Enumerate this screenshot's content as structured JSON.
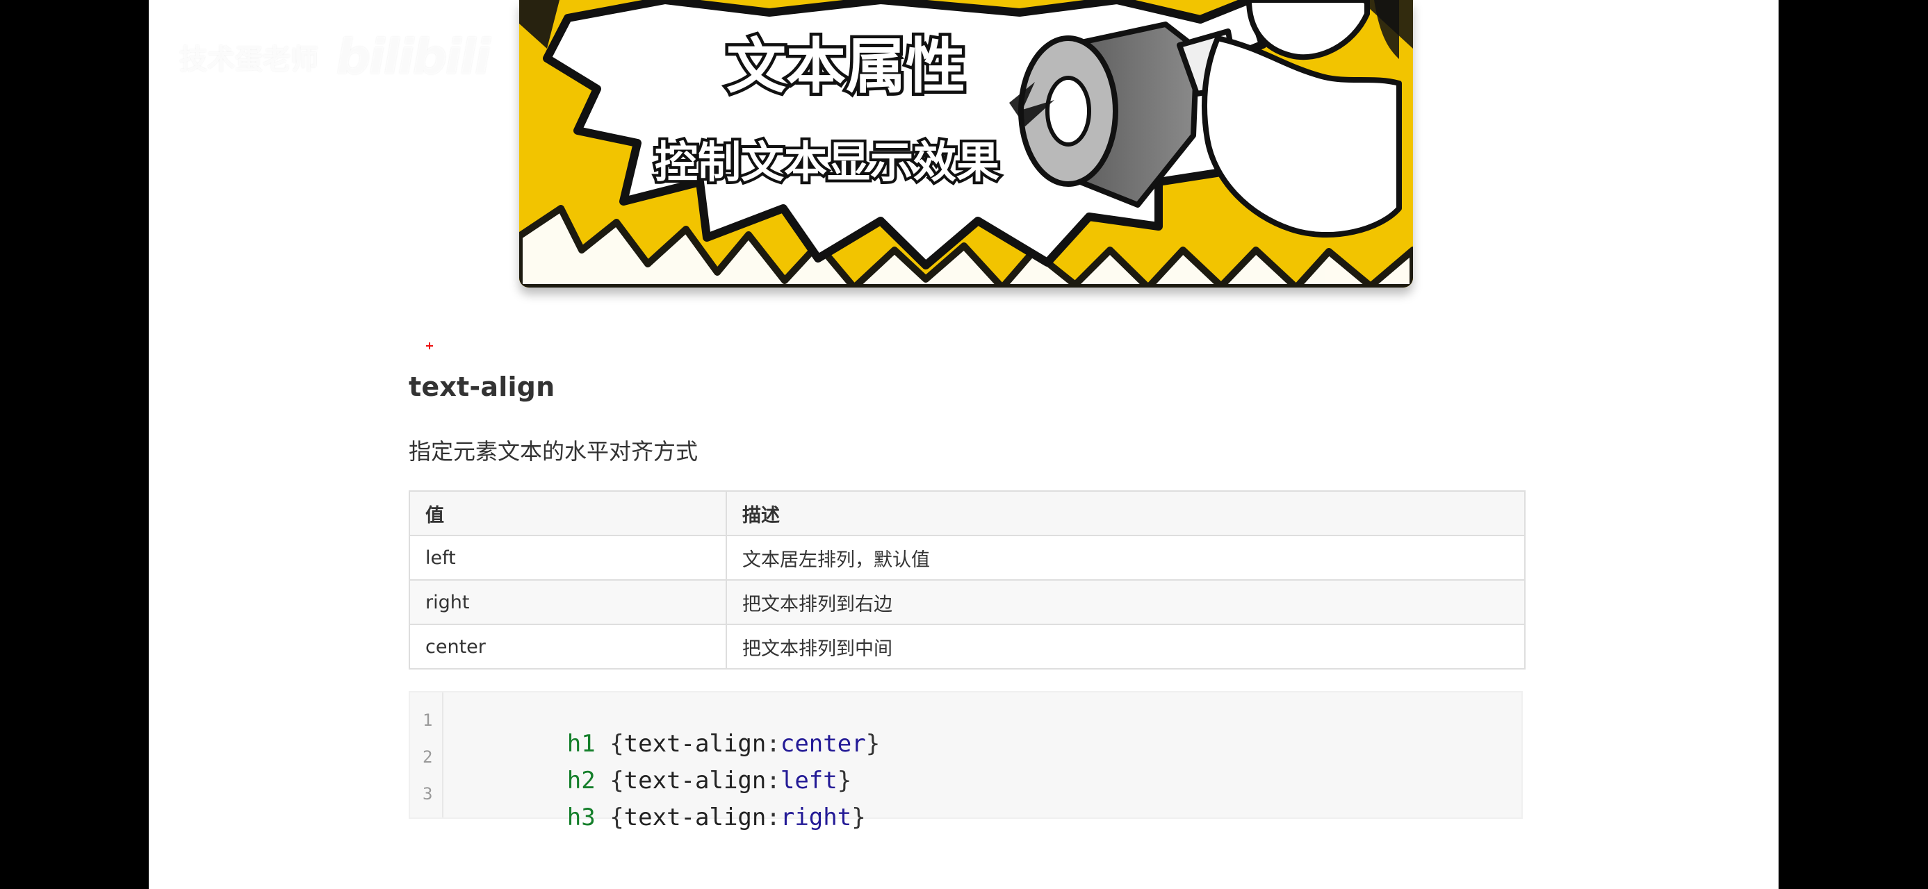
{
  "watermark": {
    "text": "技术蛋老师",
    "logo": "bilibili"
  },
  "banner": {
    "title": "文本属性",
    "subtitle": "控制文本显示效果"
  },
  "doc": {
    "heading": "text-align",
    "description": "指定元素文本的水平对齐方式",
    "table": {
      "headers": [
        "值",
        "描述"
      ],
      "rows": [
        [
          "left",
          "文本居左排列，默认值"
        ],
        [
          "right",
          "把文本排列到右边"
        ],
        [
          "center",
          "把文本排列到中间"
        ]
      ]
    },
    "code": {
      "line_numbers": [
        "1",
        "2",
        "3"
      ],
      "lines": [
        {
          "selector": "h1",
          "prop": "text-align",
          "value": "center"
        },
        {
          "selector": "h2",
          "prop": "text-align",
          "value": "left"
        },
        {
          "selector": "h3",
          "prop": "text-align",
          "value": "right"
        }
      ]
    }
  },
  "colors": {
    "banner_yellow": "#f2c400",
    "code_keyword_green": "#157f2b",
    "code_value_blue": "#231a96"
  }
}
